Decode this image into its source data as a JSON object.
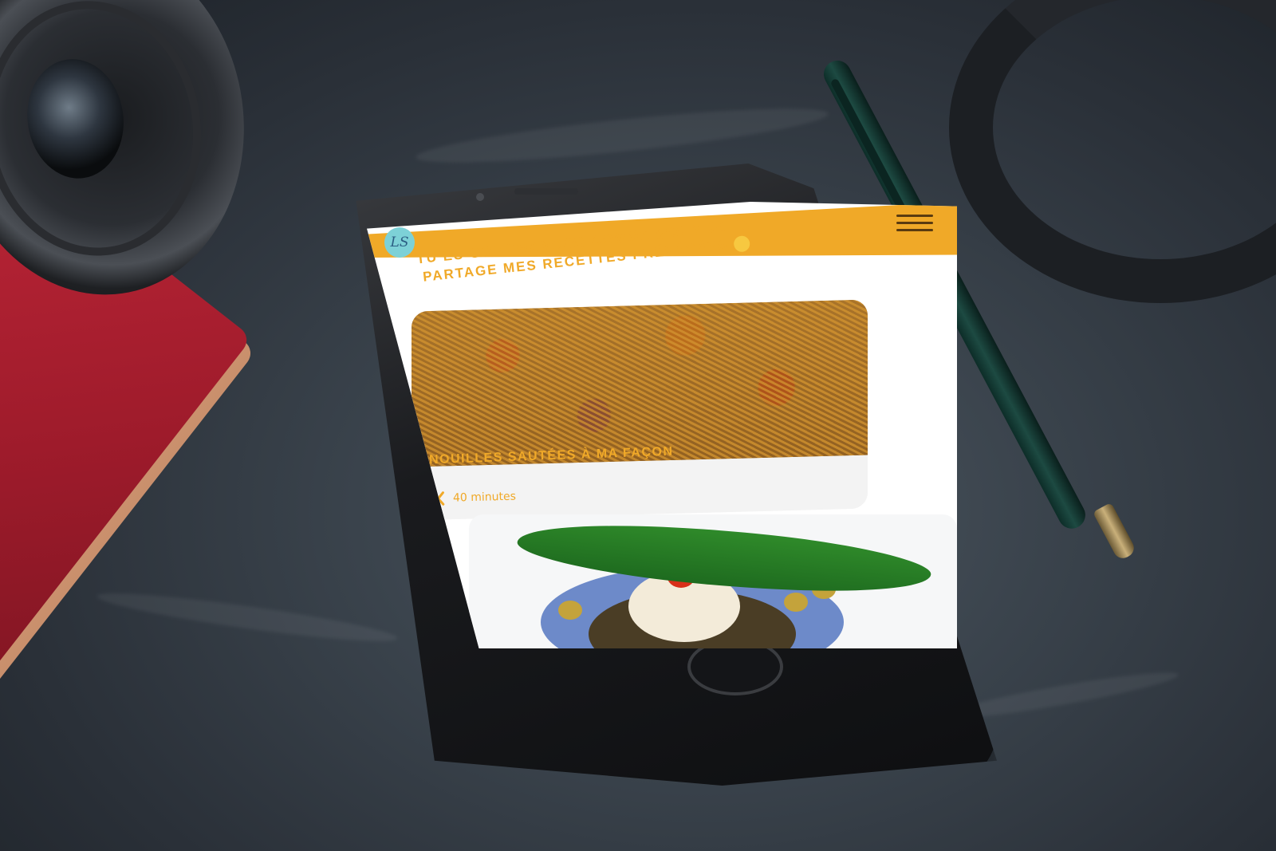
{
  "app": {
    "logo_text": "LS"
  },
  "header": {
    "headline": "TU ES GOURMAND(E) COMME MOI ? JE TE PARTAGE MES RECETTES PRÉFÉRÉES"
  },
  "recipes": [
    {
      "title": "NOUILLES SAUTÉES À MA FAÇON",
      "duration": "40 minutes"
    }
  ],
  "colors": {
    "accent": "#f0a928",
    "logo_bg": "#7dd1d7"
  },
  "icons": {
    "menu": "hamburger-icon",
    "duration": "utensils-icon",
    "emoji": "yum-face-emoji"
  }
}
